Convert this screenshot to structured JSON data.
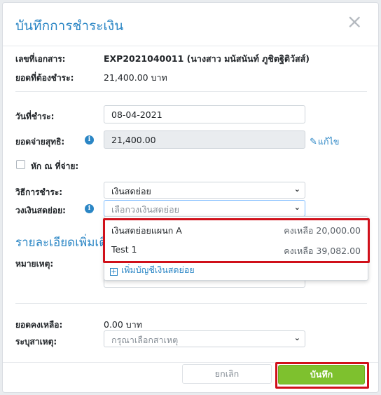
{
  "modal": {
    "title": "บันทึกการชำระเงิน",
    "close_label": "×"
  },
  "doc": {
    "doc_no_label": "เลขที่เอกสาร:",
    "doc_no_value": "EXP2021040011 (นางสาว มนัสนันท์ ภูชิตฐิติวัสส์)",
    "due_label": "ยอดที่ต้องชำระ:",
    "due_value": "21,400.00 บาท"
  },
  "payment": {
    "date_label": "วันที่ชำระ:",
    "date_value": "08-04-2021",
    "net_label": "ยอดจ่ายสุทธิ:",
    "net_value": "21,400.00",
    "edit_label": "แก้ไข",
    "wht_label": "หัก ณ ที่จ่าย:",
    "method_label": "วิธีการชำระ:",
    "method_value": "เงินสดย่อย",
    "petty_label": "วงเงินสดย่อย:",
    "petty_placeholder": "เลือกวงเงินสดย่อย"
  },
  "dropdown": {
    "options": [
      {
        "name": "เงินสดย่อยแผนก A",
        "balance": "คงเหลือ 20,000.00"
      },
      {
        "name": "Test 1",
        "balance": "คงเหลือ 39,082.00"
      }
    ],
    "add_label": "เพิ่มบัญชีเงินสดย่อย"
  },
  "details": {
    "section_title": "รายละเอียดเพิ่มเติม",
    "note_label": "หมายเหตุ:"
  },
  "summary": {
    "remain_label": "ยอดคงเหลือ:",
    "remain_value": "0.00 บาท",
    "reason_label": "ระบุสาเหตุ:",
    "reason_placeholder": "กรุณาเลือกสาเหตุ"
  },
  "footer": {
    "cancel_label": "ยกเลิก",
    "save_label": "บันทึก"
  },
  "colors": {
    "accent": "#2b86c5",
    "save_button": "#7ec12e",
    "highlight": "#d0101a"
  },
  "icons": {
    "info": "info-circle-icon",
    "edit": "pencil-square-icon",
    "add": "plus-square-icon",
    "chevron": "chevron-down-icon",
    "close": "close-icon"
  }
}
